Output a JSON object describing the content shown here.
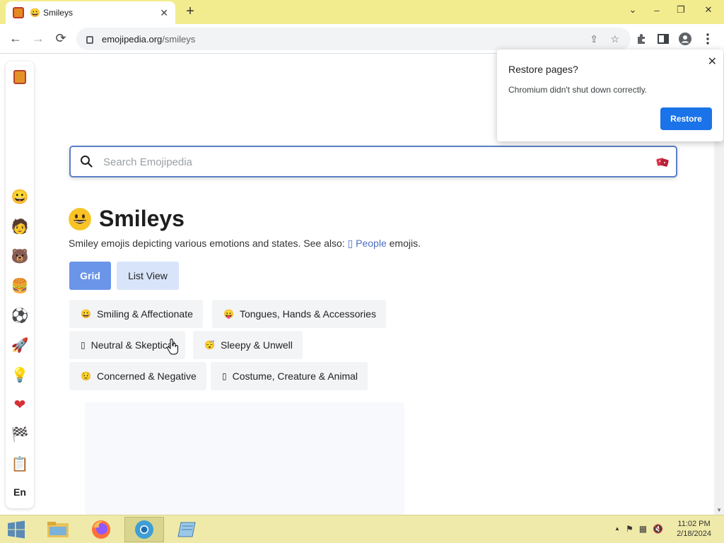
{
  "browser": {
    "tab": {
      "emoji": "😀",
      "title": "Smileys"
    },
    "new_tab_label": "+",
    "window_controls": {
      "dropdown": "⌄",
      "minimize": "–",
      "restore": "❐",
      "close": "✕"
    },
    "nav": {
      "back": "←",
      "forward": "→",
      "reload": "⟳"
    },
    "url_host": "emojipedia.org",
    "url_path": "/smileys"
  },
  "popup": {
    "title": "Restore pages?",
    "message": "Chromium didn't shut down correctly.",
    "button": "Restore",
    "close": "✕"
  },
  "sidebar": {
    "categories": [
      {
        "name": "smileys",
        "icon": "😀"
      },
      {
        "name": "people",
        "icon": "🧑"
      },
      {
        "name": "animals",
        "icon": "🐻"
      },
      {
        "name": "food",
        "icon": "🍔"
      },
      {
        "name": "activities",
        "icon": "⚽"
      },
      {
        "name": "travel",
        "icon": "🚀"
      },
      {
        "name": "objects",
        "icon": "💡"
      },
      {
        "name": "symbols",
        "icon": "❤"
      },
      {
        "name": "flags",
        "icon": "🏁"
      },
      {
        "name": "extras",
        "icon": "📋"
      }
    ],
    "language": "En"
  },
  "search": {
    "placeholder": "Search Emojipedia"
  },
  "main": {
    "title": "Smileys",
    "title_emoji": "😀",
    "description_prefix": "Smiley emojis depicting various emotions and states. See also:",
    "description_link_icon": "▯",
    "description_link": "People",
    "description_suffix": "emojis.",
    "view_grid": "Grid",
    "view_list": "List View",
    "subcategories": [
      {
        "icon": "😀",
        "label": "Smiling & Affectionate"
      },
      {
        "icon": "😛",
        "label": "Tongues, Hands & Accessories"
      },
      {
        "icon": "▯",
        "label": "Neutral & Skeptical"
      },
      {
        "icon": "😴",
        "label": "Sleepy & Unwell"
      },
      {
        "icon": "😟",
        "label": "Concerned & Negative"
      },
      {
        "icon": "▯",
        "label": "Costume, Creature & Animal"
      }
    ]
  },
  "taskbar": {
    "time": "11:02 PM",
    "date": "2/18/2024",
    "tray_arrow": "▲"
  },
  "colors": {
    "tabstrip": "#f3ec8e",
    "search_border": "#5b7fc7",
    "grid_button": "#6a95e8",
    "list_button": "#d8e4f9",
    "restore_button": "#1a73e8",
    "link": "#4a6fc5"
  }
}
